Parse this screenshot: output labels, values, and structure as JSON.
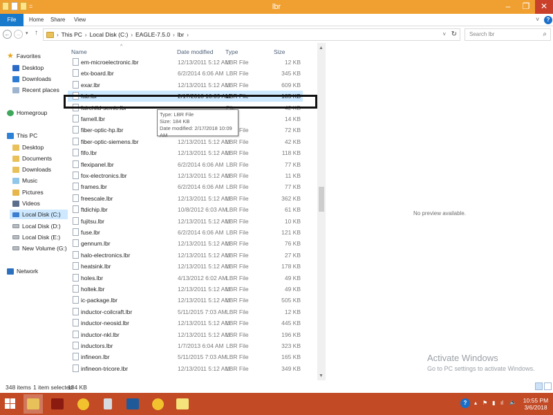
{
  "window": {
    "title": "lbr",
    "minimize_glyph": "–",
    "maximize_glyph": "❐",
    "close_glyph": "✕"
  },
  "ribbon": {
    "tabs": [
      "File",
      "Home",
      "Share",
      "View"
    ],
    "expand_glyph": "˅",
    "help_glyph": "?"
  },
  "nav": {
    "back_glyph": "←",
    "forward_glyph": "→",
    "recent_glyph": "▾",
    "up_glyph": "↑"
  },
  "address": {
    "crumbs": [
      "This PC",
      "Local Disk (C:)",
      "EAGLE-7.5.0",
      "lbr"
    ],
    "separator": "›",
    "dropdown_glyph": "˅",
    "refresh_glyph": "↻"
  },
  "search": {
    "placeholder": "Search lbr",
    "icon": "search-icon"
  },
  "sidebar": {
    "favorites": {
      "label": "Favorites",
      "items": [
        "Desktop",
        "Downloads",
        "Recent places"
      ]
    },
    "homegroup": "Homegroup",
    "this_pc": {
      "label": "This PC",
      "items": [
        "Desktop",
        "Documents",
        "Downloads",
        "Music",
        "Pictures",
        "Videos",
        "Local Disk (C:)",
        "Local Disk (D:)",
        "Local Disk (E:)",
        "New Volume (G:)"
      ]
    },
    "network": "Network"
  },
  "columns": {
    "name": "Name",
    "date": "Date modified",
    "type": "Type",
    "size": "Size"
  },
  "files": [
    {
      "name": "em-microelectronic.lbr",
      "date": "12/13/2011 5:12 AM",
      "type": "LBR File",
      "size": "12 KB"
    },
    {
      "name": "etx-board.lbr",
      "date": "6/2/2014 6:06 AM",
      "type": "LBR File",
      "size": "345 KB"
    },
    {
      "name": "exar.lbr",
      "date": "12/13/2011 5:12 AM",
      "type": "LBR File",
      "size": "609 KB"
    },
    {
      "name": "fab.lbr",
      "date": "2/17/2018 10:09 AM",
      "type": "LBR File",
      "size": "185 KB"
    },
    {
      "name": "fairchild-semic.lbr",
      "date": "",
      "type": "File",
      "size": "42 KB"
    },
    {
      "name": "farnell.lbr",
      "date": "",
      "type": "File",
      "size": "14 KB"
    },
    {
      "name": "fiber-optic-hp.lbr",
      "date": "",
      "type": "LBR File",
      "size": "72 KB"
    },
    {
      "name": "fiber-optic-siemens.lbr",
      "date": "12/13/2011 5:12 AM",
      "type": "LBR File",
      "size": "42 KB"
    },
    {
      "name": "fifo.lbr",
      "date": "12/13/2011 5:12 AM",
      "type": "LBR File",
      "size": "118 KB"
    },
    {
      "name": "flexipanel.lbr",
      "date": "6/2/2014 6:06 AM",
      "type": "LBR File",
      "size": "77 KB"
    },
    {
      "name": "fox-electronics.lbr",
      "date": "12/13/2011 5:12 AM",
      "type": "LBR File",
      "size": "11 KB"
    },
    {
      "name": "frames.lbr",
      "date": "6/2/2014 6:06 AM",
      "type": "LBR File",
      "size": "77 KB"
    },
    {
      "name": "freescale.lbr",
      "date": "12/13/2011 5:12 AM",
      "type": "LBR File",
      "size": "362 KB"
    },
    {
      "name": "ftdichip.lbr",
      "date": "10/8/2012 6:03 AM",
      "type": "LBR File",
      "size": "61 KB"
    },
    {
      "name": "fujitsu.lbr",
      "date": "12/13/2011 5:12 AM",
      "type": "LBR File",
      "size": "10 KB"
    },
    {
      "name": "fuse.lbr",
      "date": "6/2/2014 6:06 AM",
      "type": "LBR File",
      "size": "121 KB"
    },
    {
      "name": "gennum.lbr",
      "date": "12/13/2011 5:12 AM",
      "type": "LBR File",
      "size": "76 KB"
    },
    {
      "name": "halo-electronics.lbr",
      "date": "12/13/2011 5:12 AM",
      "type": "LBR File",
      "size": "27 KB"
    },
    {
      "name": "heatsink.lbr",
      "date": "12/13/2011 5:12 AM",
      "type": "LBR File",
      "size": "178 KB"
    },
    {
      "name": "holes.lbr",
      "date": "4/13/2012 6:02 AM",
      "type": "LBR File",
      "size": "49 KB"
    },
    {
      "name": "holtek.lbr",
      "date": "12/13/2011 5:12 AM",
      "type": "LBR File",
      "size": "49 KB"
    },
    {
      "name": "ic-package.lbr",
      "date": "12/13/2011 5:12 AM",
      "type": "LBR File",
      "size": "505 KB"
    },
    {
      "name": "inductor-coilcraft.lbr",
      "date": "5/11/2015 7:03 AM",
      "type": "LBR File",
      "size": "12 KB"
    },
    {
      "name": "inductor-neosid.lbr",
      "date": "12/13/2011 5:12 AM",
      "type": "LBR File",
      "size": "445 KB"
    },
    {
      "name": "inductor-nkl.lbr",
      "date": "12/13/2011 5:12 AM",
      "type": "LBR File",
      "size": "196 KB"
    },
    {
      "name": "inductors.lbr",
      "date": "1/7/2013 6:04 AM",
      "type": "LBR File",
      "size": "323 KB"
    },
    {
      "name": "infineon.lbr",
      "date": "5/11/2015 7:03 AM",
      "type": "LBR File",
      "size": "165 KB"
    },
    {
      "name": "infineon-tricore.lbr",
      "date": "12/13/2011 5:12 AM",
      "type": "LBR File",
      "size": "349 KB"
    }
  ],
  "tooltip": {
    "type_line": "Type: LBR File",
    "size_line": "Size: 184 KB",
    "date_line": "Date modified: 2/17/2018 10:09 AM"
  },
  "preview": {
    "text": "No preview available."
  },
  "watermark": {
    "title": "Activate Windows",
    "subtitle": "Go to PC settings to activate Windows."
  },
  "status": {
    "item_count": "348 items",
    "selection": "1 item selected",
    "selection_size": "184 KB"
  },
  "taskbar": {
    "apps": [
      "file-explorer",
      "acrobat",
      "chrome",
      "calculator",
      "app-window",
      "chrome",
      "sticky-notes"
    ],
    "tray": {
      "help_glyph": "?",
      "chevron_glyph": "▴",
      "flag_glyph": "⚑",
      "network_glyph": "▮",
      "signal_glyph": "ıl",
      "volume_glyph": "🔈"
    },
    "time": "10:55 PM",
    "date": "3/6/2018"
  },
  "colors": {
    "accent": "#1979ca",
    "titlebar": "#f0a030",
    "taskbar": "#c24a25",
    "selection": "#cce8ff"
  }
}
